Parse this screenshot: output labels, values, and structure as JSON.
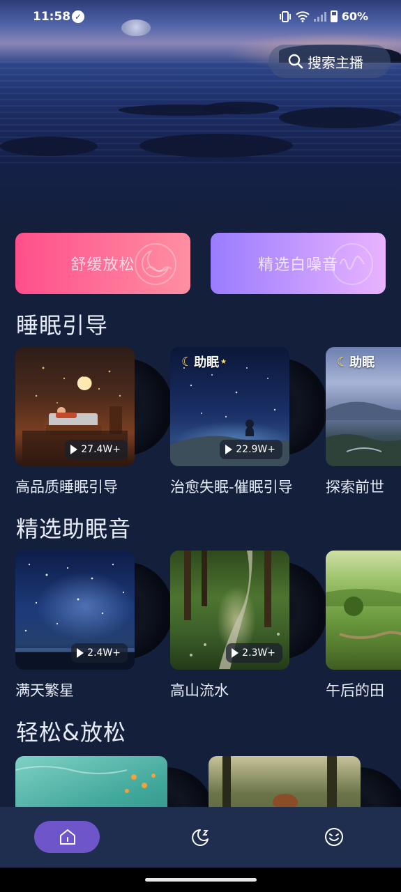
{
  "status_bar": {
    "time": "11:58",
    "battery": "60%"
  },
  "search": {
    "label": "搜索主播",
    "icon": "search-icon"
  },
  "categories": [
    {
      "label": "舒缓放松",
      "icon": "moon-wave-icon",
      "color_start": "#ff4f8b",
      "color_end": "#ff8fa2"
    },
    {
      "label": "精选白噪音",
      "icon": "sound-wave-icon",
      "color_start": "#9a7cff",
      "color_end": "#e9b3ff"
    }
  ],
  "sections": [
    {
      "title": "睡眠引导",
      "items": [
        {
          "title": "高品质睡眠引导",
          "plays": "27.4W+",
          "tag": ""
        },
        {
          "title": "治愈失眠-催眠引导",
          "plays": "22.9W+",
          "tag": "助眠"
        },
        {
          "title": "探索前世",
          "plays": "",
          "tag": "助眠"
        }
      ]
    },
    {
      "title": "精选助眠音",
      "items": [
        {
          "title": "满天繁星",
          "plays": "2.4W+",
          "tag": ""
        },
        {
          "title": "高山流水",
          "plays": "2.3W+",
          "tag": ""
        },
        {
          "title": "午后的田",
          "plays": "",
          "tag": ""
        }
      ]
    },
    {
      "title": "轻松&放松",
      "items": [
        {
          "title": "",
          "plays": "",
          "tag": ""
        },
        {
          "title": "",
          "plays": "",
          "tag": ""
        }
      ]
    }
  ],
  "bottom_nav": [
    {
      "icon": "home-icon",
      "active": true
    },
    {
      "icon": "sleep-moon-icon",
      "active": false
    },
    {
      "icon": "smile-face-icon",
      "active": false
    }
  ],
  "colors": {
    "background": "#141f3b",
    "nav_background": "#1f2d4f",
    "active_pill": "#6e55c9"
  }
}
